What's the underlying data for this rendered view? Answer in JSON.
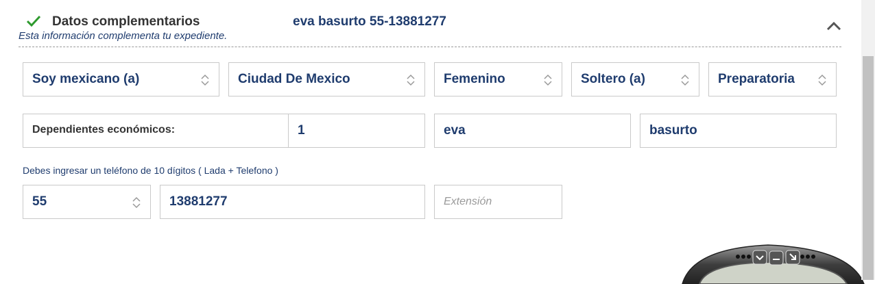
{
  "section": {
    "title": "Datos complementarios",
    "summary": "eva basurto 55-13881277",
    "subtitle": "Esta información complementa tu expediente."
  },
  "selects_row1": [
    {
      "value": "Soy mexicano (a)"
    },
    {
      "value": "Ciudad De Mexico"
    },
    {
      "value": "Femenino"
    },
    {
      "value": "Soltero (a)"
    },
    {
      "value": "Preparatoria"
    }
  ],
  "dependents": {
    "label": "Dependientes económicos:",
    "value": "1"
  },
  "name": {
    "first": "eva",
    "last": "basurto"
  },
  "phone": {
    "help": "Debes ingresar un teléfono de 10 dígitos ( Lada + Telefono )",
    "lada": "55",
    "number": "13881277",
    "extension_placeholder": "Extensión"
  },
  "colors": {
    "accent": "#1f3c6e",
    "check": "#2e9a2e",
    "border": "#c9c9c9"
  },
  "icons": {
    "check": "check-icon",
    "collapse": "chevron-up-icon",
    "select": "up-down-arrows-icon"
  }
}
